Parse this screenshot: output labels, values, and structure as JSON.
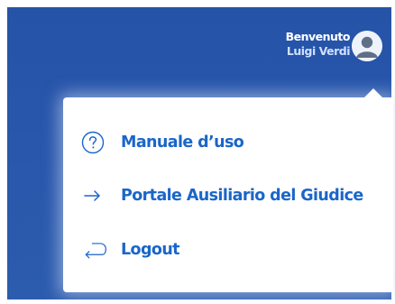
{
  "header": {
    "greeting": "Benvenuto",
    "user_name": "Luigi Verdi"
  },
  "menu": {
    "items": [
      {
        "label": "Manuale d’uso",
        "icon": "help-circle-icon"
      },
      {
        "label": "Portale Ausiliario del Giudice",
        "icon": "arrow-right-icon"
      },
      {
        "label": "Logout",
        "icon": "logout-icon"
      }
    ]
  },
  "colors": {
    "header_background": "#2a58ac",
    "link_blue": "#1a66c9",
    "white": "#ffffff"
  }
}
